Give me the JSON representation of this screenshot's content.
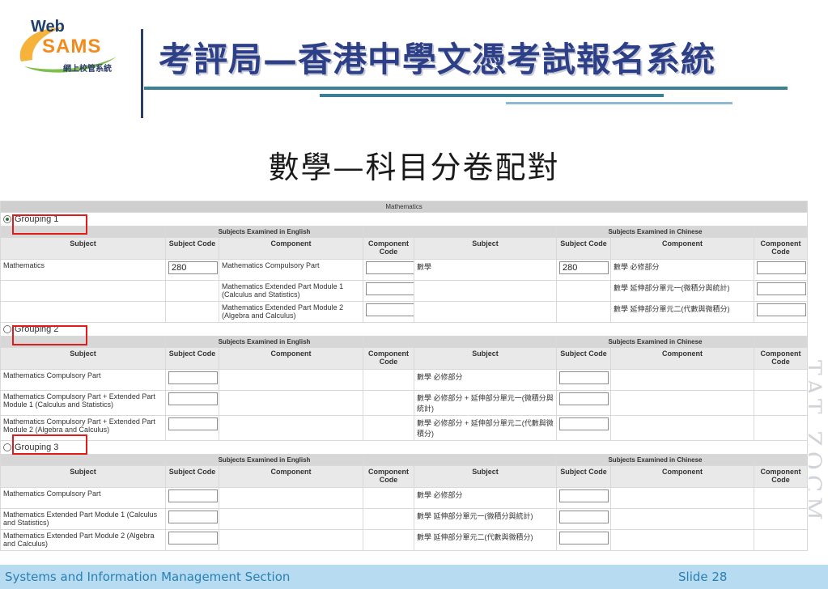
{
  "slide": {
    "logo": {
      "line1": "Web",
      "line2": "SAMS",
      "line3": "網上校管系統"
    },
    "title": "考評局—香港中學文憑考試報名系統",
    "subtitle": "數學—科目分卷配對",
    "footer_left": "Systems and Information Management Section",
    "footer_right": "Slide 28",
    "watermark": "TAT ZOCM"
  },
  "form": {
    "subject_bar": "Mathematics",
    "sections": {
      "english": "Subjects Examined in English",
      "chinese": "Subjects Examined in Chinese"
    },
    "headers": {
      "subject": "Subject",
      "subject_code": "Subject Code",
      "component": "Component",
      "component_code": "Component Code"
    },
    "groups": [
      {
        "label": "Grouping 1",
        "selected": true,
        "rows": [
          {
            "en_subject": "Mathematics",
            "en_code": "280",
            "en_component": "Mathematics Compulsory Part",
            "cn_subject": "數學",
            "cn_code": "280",
            "cn_component": "數學 必修部分"
          },
          {
            "en_subject": "",
            "en_code": "",
            "en_component": "Mathematics Extended Part Module 1 (Calculus and Statistics)",
            "cn_subject": "",
            "cn_code": "",
            "cn_component": "數學 延伸部分單元一(微積分與統計)"
          },
          {
            "en_subject": "",
            "en_code": "",
            "en_component": "Mathematics Extended Part Module 2 (Algebra and Calculus)",
            "cn_subject": "",
            "cn_code": "",
            "cn_component": "數學 延伸部分單元二(代數與微積分)"
          }
        ]
      },
      {
        "label": "Grouping 2",
        "selected": false,
        "rows": [
          {
            "en_subject": "Mathematics Compulsory Part",
            "cn_subject": "數學 必修部分"
          },
          {
            "en_subject": "Mathematics Compulsory Part + Extended Part Module 1 (Calculus and Statistics)",
            "cn_subject": "數學 必修部分 + 延伸部分單元一(微積分與統計)"
          },
          {
            "en_subject": "Mathematics Compulsory Part + Extended Part Module 2 (Algebra and Calculus)",
            "cn_subject": "數學 必修部分 + 延伸部分單元二(代數與微積分)"
          }
        ]
      },
      {
        "label": "Grouping 3",
        "selected": false,
        "rows": [
          {
            "en_subject": "Mathematics Compulsory Part",
            "cn_subject": "數學 必修部分"
          },
          {
            "en_subject": "Mathematics Extended Part Module 1 (Calculus and Statistics)",
            "cn_subject": "數學 延伸部分單元一(微積分與統計)"
          },
          {
            "en_subject": "Mathematics Extended Part Module 2 (Algebra and Calculus)",
            "cn_subject": "數學 延伸部分單元二(代數與微積分)"
          }
        ]
      }
    ]
  }
}
